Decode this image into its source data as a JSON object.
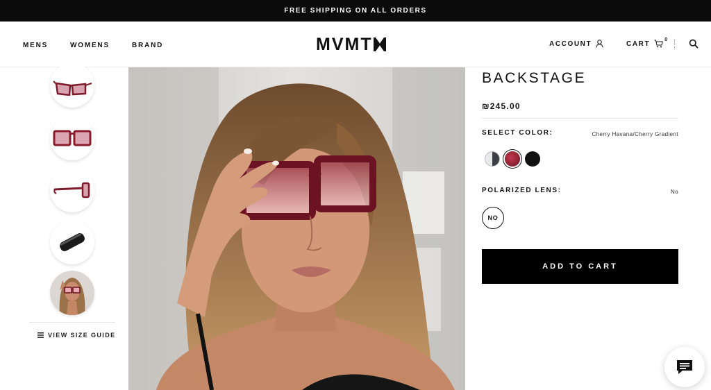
{
  "promo": {
    "text": "FREE SHIPPING ON ALL ORDERS"
  },
  "nav": {
    "mens": "MENS",
    "womens": "WOMENS",
    "brand": "BRAND"
  },
  "logo": {
    "text": "MVMT"
  },
  "header_right": {
    "account": "ACCOUNT",
    "cart": "CART",
    "cart_count": "0"
  },
  "gallery": {
    "thumbnails": [
      {
        "name": "angled-view"
      },
      {
        "name": "front-view"
      },
      {
        "name": "side-view"
      },
      {
        "name": "case-view"
      },
      {
        "name": "model-view"
      }
    ],
    "size_guide": "VIEW SIZE GUIDE"
  },
  "product": {
    "title": "BACKSTAGE",
    "price": "₪245.00",
    "color_label": "SELECT COLOR:",
    "color_value": "Cherry Havana/Cherry Gradient",
    "colors": [
      "#b9bcc2",
      "#8f1d2c",
      "#111111"
    ],
    "selected_color_index": 1,
    "lens_label": "POLARIZED LENS:",
    "lens_value": "No",
    "lens_option": "NO",
    "add_to_cart": "ADD TO CART"
  },
  "theme": {
    "accent": "#000000",
    "frame_red": "#8f1d2c"
  }
}
